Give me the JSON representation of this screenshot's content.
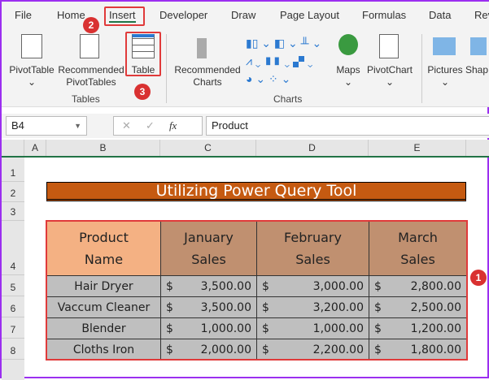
{
  "tabs": [
    "File",
    "Home",
    "Insert",
    "Developer",
    "Draw",
    "Page Layout",
    "Formulas",
    "Data",
    "Rev"
  ],
  "ribbon": {
    "pivottable": "PivotTable",
    "recommended_pivot": [
      "Recommended",
      "PivotTables"
    ],
    "table": "Table",
    "recommended_charts": [
      "Recommended",
      "Charts"
    ],
    "maps": "Maps",
    "pivotchart": "PivotChart",
    "pictures": "Pictures",
    "shapes": "Shap",
    "group_tables": "Tables",
    "group_charts": "Charts"
  },
  "badges": [
    "1",
    "2",
    "3"
  ],
  "formula_bar": {
    "name_box": "B4",
    "fx": "fx",
    "value": "Product"
  },
  "columns": [
    "A",
    "B",
    "C",
    "D",
    "E"
  ],
  "rows": [
    "1",
    "2",
    "3",
    "4",
    "5",
    "6",
    "7",
    "8"
  ],
  "sheet": {
    "title": "Utilizing Power Query Tool",
    "headers": [
      [
        "Product",
        "Name"
      ],
      [
        "January",
        "Sales"
      ],
      [
        "February",
        "Sales"
      ],
      [
        "March",
        "Sales"
      ]
    ],
    "currency": "$",
    "data": [
      {
        "name": "Hair Dryer",
        "jan": "3,500.00",
        "feb": "3,000.00",
        "mar": "2,800.00"
      },
      {
        "name": "Vaccum Cleaner",
        "jan": "3,500.00",
        "feb": "3,200.00",
        "mar": "2,500.00"
      },
      {
        "name": "Blender",
        "jan": "1,000.00",
        "feb": "1,000.00",
        "mar": "1,200.00"
      },
      {
        "name": "Cloths Iron",
        "jan": "2,000.00",
        "feb": "2,200.00",
        "mar": "1,800.00"
      }
    ]
  }
}
